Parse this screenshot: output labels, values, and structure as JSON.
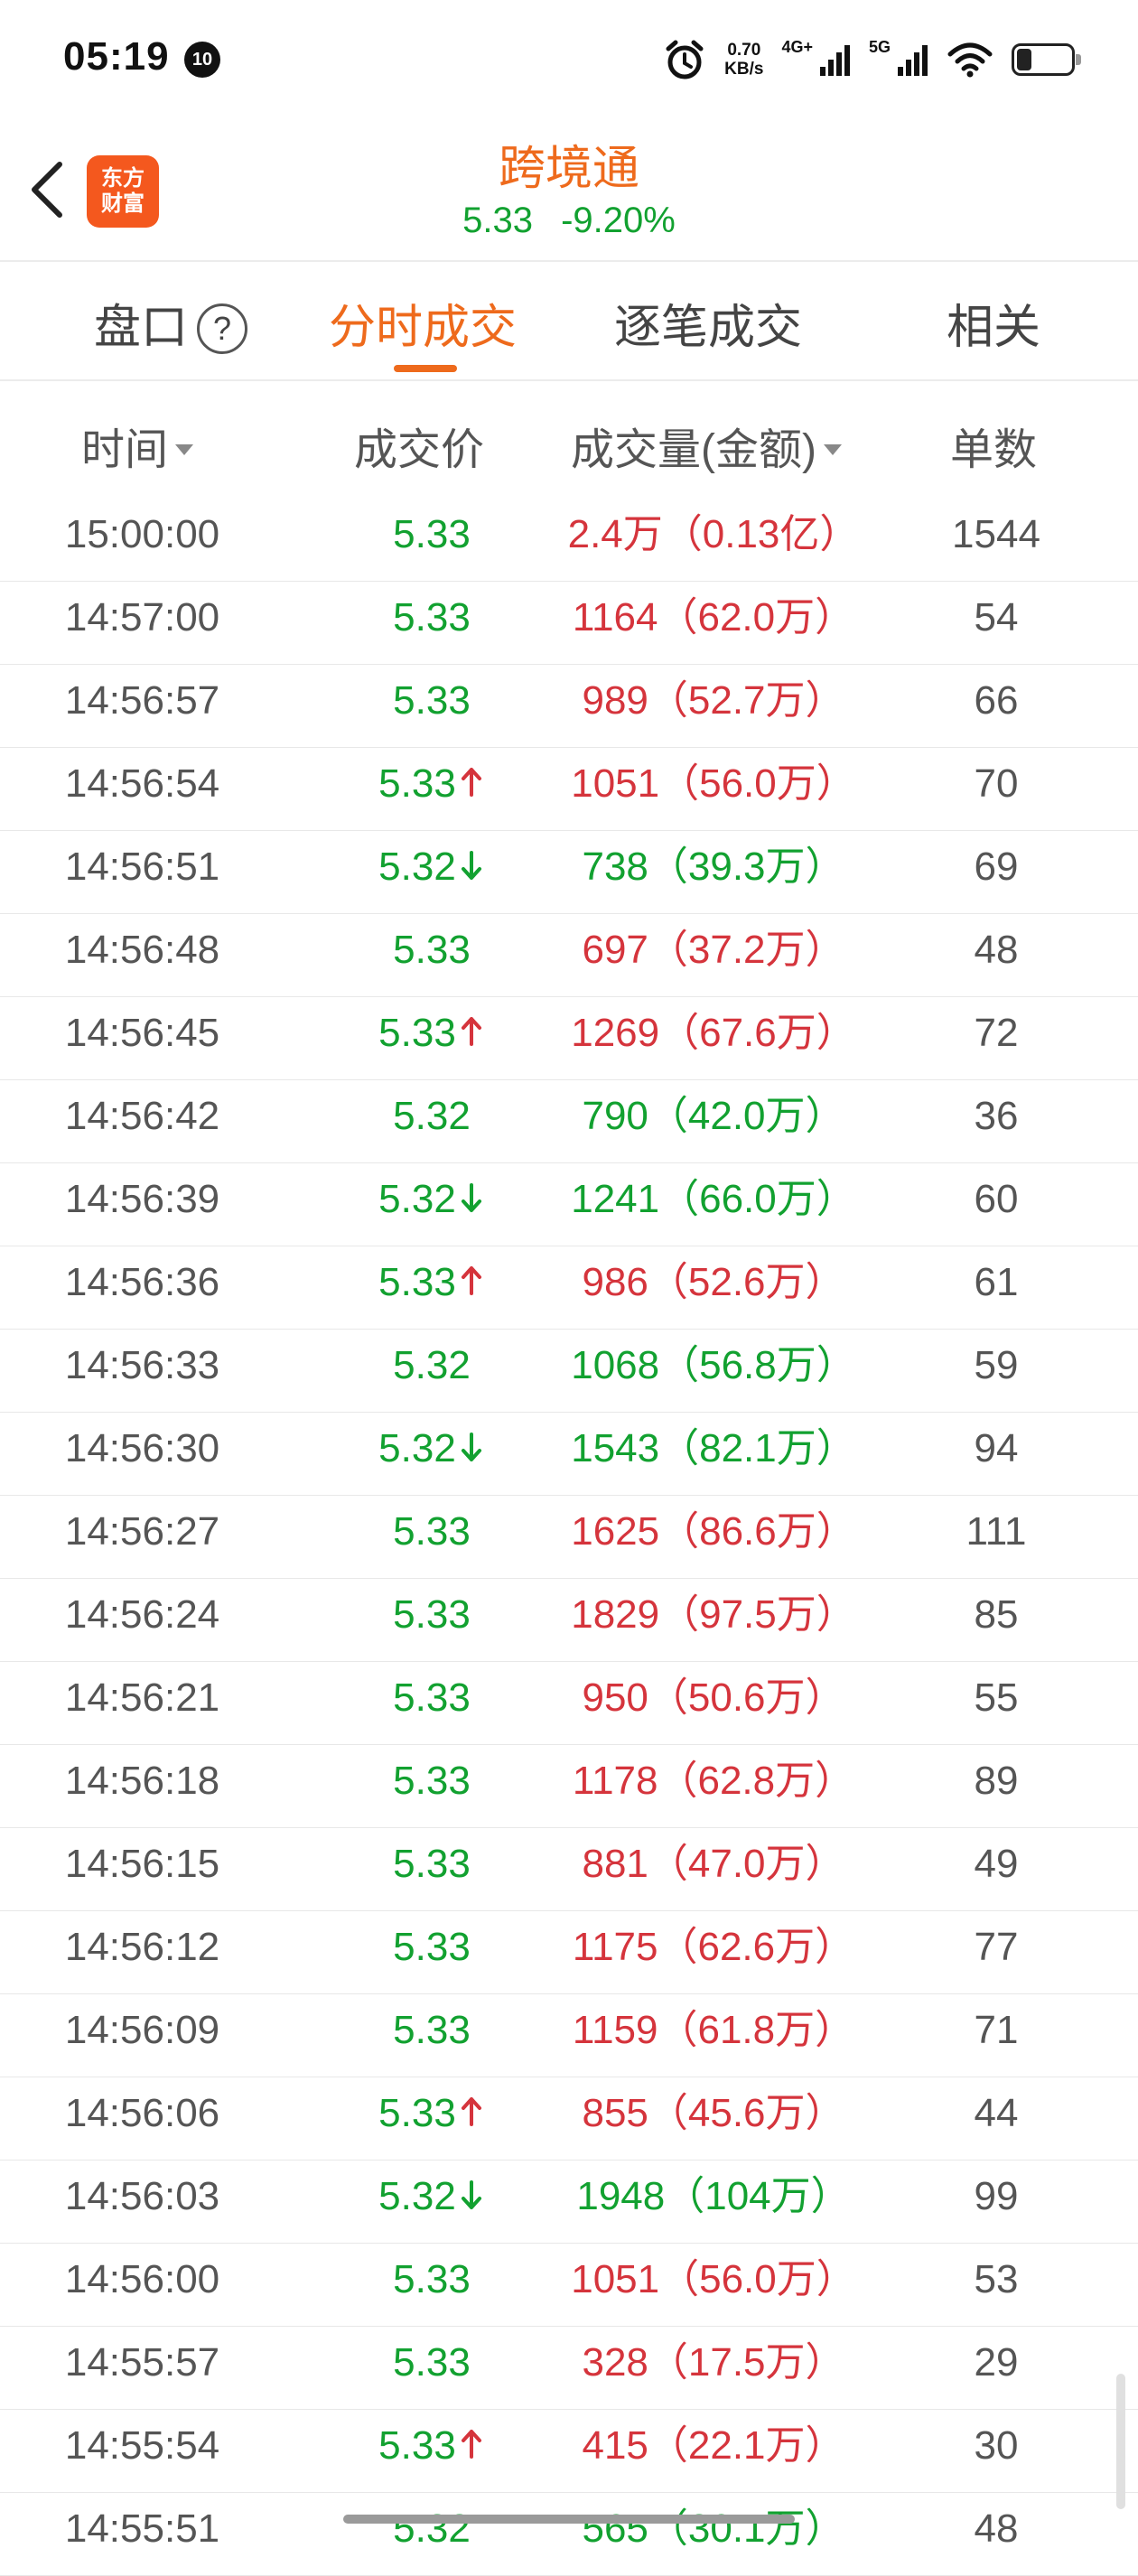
{
  "status_bar": {
    "time": "05:19",
    "notification_badge": "10",
    "net_speed_value": "0.70",
    "net_speed_unit": "KB/s",
    "network_1": "4G+",
    "network_2": "5G"
  },
  "header": {
    "logo_line1": "东方",
    "logo_line2": "财富",
    "stock_name": "跨境通",
    "price": "5.33",
    "change_pct": "-9.20%"
  },
  "tabs": [
    {
      "label": "盘口",
      "active": false
    },
    {
      "label": "分时成交",
      "active": true
    },
    {
      "label": "逐笔成交",
      "active": false
    },
    {
      "label": "相关",
      "active": false
    }
  ],
  "help_glyph": "?",
  "columns": [
    "时间",
    "成交价",
    "成交量(金额)",
    "单数"
  ],
  "colors": {
    "up": "#d5343c",
    "down": "#12a130",
    "accent": "#ee6a1c"
  },
  "rows": [
    {
      "time": "15:00:00",
      "price": "5.33",
      "arrow": "",
      "volume": "2.4万（0.13亿）",
      "dir": "up",
      "count": "1544"
    },
    {
      "time": "14:57:00",
      "price": "5.33",
      "arrow": "",
      "volume": "1164（62.0万）",
      "dir": "up",
      "count": "54"
    },
    {
      "time": "14:56:57",
      "price": "5.33",
      "arrow": "",
      "volume": "989（52.7万）",
      "dir": "up",
      "count": "66"
    },
    {
      "time": "14:56:54",
      "price": "5.33",
      "arrow": "up",
      "volume": "1051（56.0万）",
      "dir": "up",
      "count": "70"
    },
    {
      "time": "14:56:51",
      "price": "5.32",
      "arrow": "down",
      "volume": "738（39.3万）",
      "dir": "down",
      "count": "69"
    },
    {
      "time": "14:56:48",
      "price": "5.33",
      "arrow": "",
      "volume": "697（37.2万）",
      "dir": "up",
      "count": "48"
    },
    {
      "time": "14:56:45",
      "price": "5.33",
      "arrow": "up",
      "volume": "1269（67.6万）",
      "dir": "up",
      "count": "72"
    },
    {
      "time": "14:56:42",
      "price": "5.32",
      "arrow": "",
      "volume": "790（42.0万）",
      "dir": "down",
      "count": "36"
    },
    {
      "time": "14:56:39",
      "price": "5.32",
      "arrow": "down",
      "volume": "1241（66.0万）",
      "dir": "down",
      "count": "60"
    },
    {
      "time": "14:56:36",
      "price": "5.33",
      "arrow": "up",
      "volume": "986（52.6万）",
      "dir": "up",
      "count": "61"
    },
    {
      "time": "14:56:33",
      "price": "5.32",
      "arrow": "",
      "volume": "1068（56.8万）",
      "dir": "down",
      "count": "59"
    },
    {
      "time": "14:56:30",
      "price": "5.32",
      "arrow": "down",
      "volume": "1543（82.1万）",
      "dir": "down",
      "count": "94"
    },
    {
      "time": "14:56:27",
      "price": "5.33",
      "arrow": "",
      "volume": "1625（86.6万）",
      "dir": "up",
      "count": "111"
    },
    {
      "time": "14:56:24",
      "price": "5.33",
      "arrow": "",
      "volume": "1829（97.5万）",
      "dir": "up",
      "count": "85"
    },
    {
      "time": "14:56:21",
      "price": "5.33",
      "arrow": "",
      "volume": "950（50.6万）",
      "dir": "up",
      "count": "55"
    },
    {
      "time": "14:56:18",
      "price": "5.33",
      "arrow": "",
      "volume": "1178（62.8万）",
      "dir": "up",
      "count": "89"
    },
    {
      "time": "14:56:15",
      "price": "5.33",
      "arrow": "",
      "volume": "881（47.0万）",
      "dir": "up",
      "count": "49"
    },
    {
      "time": "14:56:12",
      "price": "5.33",
      "arrow": "",
      "volume": "1175（62.6万）",
      "dir": "up",
      "count": "77"
    },
    {
      "time": "14:56:09",
      "price": "5.33",
      "arrow": "",
      "volume": "1159（61.8万）",
      "dir": "up",
      "count": "71"
    },
    {
      "time": "14:56:06",
      "price": "5.33",
      "arrow": "up",
      "volume": "855（45.6万）",
      "dir": "up",
      "count": "44"
    },
    {
      "time": "14:56:03",
      "price": "5.32",
      "arrow": "down",
      "volume": "1948（104万）",
      "dir": "down",
      "count": "99"
    },
    {
      "time": "14:56:00",
      "price": "5.33",
      "arrow": "",
      "volume": "1051（56.0万）",
      "dir": "up",
      "count": "53"
    },
    {
      "time": "14:55:57",
      "price": "5.33",
      "arrow": "",
      "volume": "328（17.5万）",
      "dir": "up",
      "count": "29"
    },
    {
      "time": "14:55:54",
      "price": "5.33",
      "arrow": "up",
      "volume": "415（22.1万）",
      "dir": "up",
      "count": "30"
    },
    {
      "time": "14:55:51",
      "price": "5.32",
      "arrow": "",
      "volume": "565（30.1万）",
      "dir": "down",
      "count": "48"
    }
  ]
}
